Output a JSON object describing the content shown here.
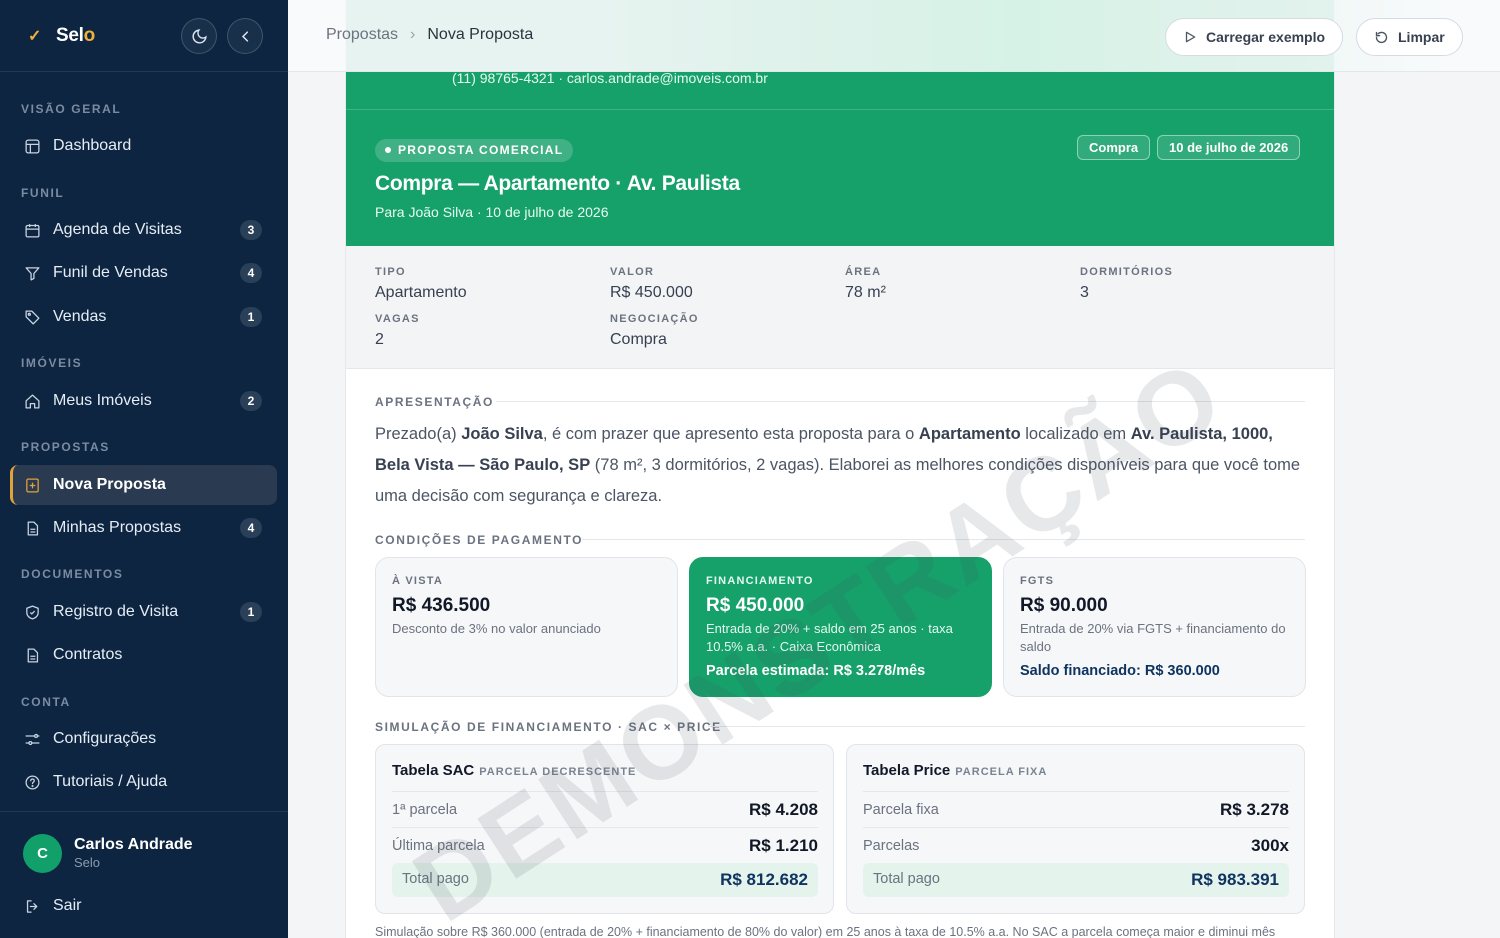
{
  "app": {
    "brand": "Selo"
  },
  "sidebar": {
    "sections": {
      "visao_geral": "VISÃO GERAL",
      "funil": "FUNIL",
      "imoveis": "IMÓVEIS",
      "propostas": "PROPOSTAS",
      "documentos": "DOCUMENTOS",
      "conta": "CONTA"
    },
    "items": [
      {
        "label": "Dashboard",
        "count": null,
        "icon": "layout-icon"
      },
      {
        "label": "Agenda de Visitas",
        "count": "3",
        "icon": "calendar-icon"
      },
      {
        "label": "Funil de Vendas",
        "count": "4",
        "icon": "filter-icon"
      },
      {
        "label": "Vendas",
        "count": "1",
        "icon": "tag-icon"
      },
      {
        "label": "Meus Imóveis",
        "count": "2",
        "icon": "home-icon"
      },
      {
        "label": "Nova Proposta",
        "count": null,
        "icon": "plus-doc-icon",
        "active": true
      },
      {
        "label": "Minhas Propostas",
        "count": "4",
        "icon": "document-icon"
      },
      {
        "label": "Registro de Visita",
        "count": "1",
        "icon": "shield-icon"
      },
      {
        "label": "Contratos",
        "count": null,
        "icon": "document-icon"
      },
      {
        "label": "Configurações",
        "count": null,
        "icon": "sliders-icon"
      },
      {
        "label": "Tutoriais / Ajuda",
        "count": null,
        "icon": "help-icon"
      }
    ],
    "user": {
      "initial": "C",
      "name": "Carlos Andrade",
      "role": "Selo"
    },
    "logout": "Sair"
  },
  "topbar": {
    "breadcrumb": {
      "parent": "Propostas",
      "separator": "›",
      "current": "Nova Proposta"
    },
    "load_example": "Carregar exemplo",
    "clear": "Limpar"
  },
  "proposal": {
    "contact": "(11) 98765-4321 · carlos.andrade@imoveis.com.br",
    "tag": "PROPOSTA COMERCIAL",
    "badge_type": "Compra",
    "badge_date": "10 de julho de 2026",
    "title": "Compra — Apartamento · Av. Paulista",
    "subtitle": "Para João Silva · 10 de julho de 2026",
    "facts": {
      "tipo": {
        "k": "TIPO",
        "v": "Apartamento"
      },
      "valor": {
        "k": "VALOR",
        "v": "R$ 450.000"
      },
      "area": {
        "k": "ÁREA",
        "v": "78 m²"
      },
      "dorm": {
        "k": "DORMITÓRIOS",
        "v": "3"
      },
      "vagas": {
        "k": "VAGAS",
        "v": "2"
      },
      "neg": {
        "k": "NEGOCIAÇÃO",
        "v": "Compra"
      }
    },
    "presentation": {
      "heading": "APRESENTAÇÃO",
      "t1": "Prezado(a) ",
      "client": "João Silva",
      "t2": ", é com prazer que apresento esta proposta para o ",
      "property": "Apartamento",
      "t3": " localizado em ",
      "address": "Av. Paulista, 1000, Bela Vista — São Paulo, SP",
      "t4": " (78 m², 3 dormitórios, 2 vagas). Elaborei as melhores condições disponíveis para que você tome uma decisão com segurança e clareza."
    },
    "payment": {
      "heading": "CONDIÇÕES DE PAGAMENTO",
      "cards": [
        {
          "key": "À VISTA",
          "value": "R$ 436.500",
          "desc": "Desconto de 3% no valor anunciado",
          "extra": ""
        },
        {
          "key": "FINANCIAMENTO",
          "value": "R$ 450.000",
          "desc": "Entrada de 20% + saldo em 25 anos · taxa 10.5% a.a. · Caixa Econômica",
          "extra": "Parcela estimada: R$ 3.278/mês"
        },
        {
          "key": "FGTS",
          "value": "R$ 90.000",
          "desc": "Entrada de 20% via FGTS + financiamento do saldo",
          "extra": "Saldo financiado: R$ 360.000"
        }
      ]
    },
    "simulation": {
      "heading": "SIMULAÇÃO DE FINANCIAMENTO · SAC × PRICE",
      "sac": {
        "title": "Tabela SAC",
        "sub": "PARCELA DECRESCENTE",
        "r1k": "1ª parcela",
        "r1v": "R$ 4.208",
        "r2k": "Última parcela",
        "r2v": "R$ 1.210",
        "tk": "Total pago",
        "tv": "R$ 812.682"
      },
      "price": {
        "title": "Tabela Price",
        "sub": "PARCELA FIXA",
        "r1k": "Parcela fixa",
        "r1v": "R$ 3.278",
        "r2k": "Parcelas",
        "r2v": "300x",
        "tk": "Total pago",
        "tv": "R$ 983.391"
      }
    },
    "footnote": "Simulação sobre R$ 360.000 (entrada de 20% + financiamento de 80% do valor) em 25 anos à taxa de 10.5% a.a. No SAC a parcela começa maior e diminui mês",
    "watermark": "DEMONSTRAÇÃO"
  }
}
